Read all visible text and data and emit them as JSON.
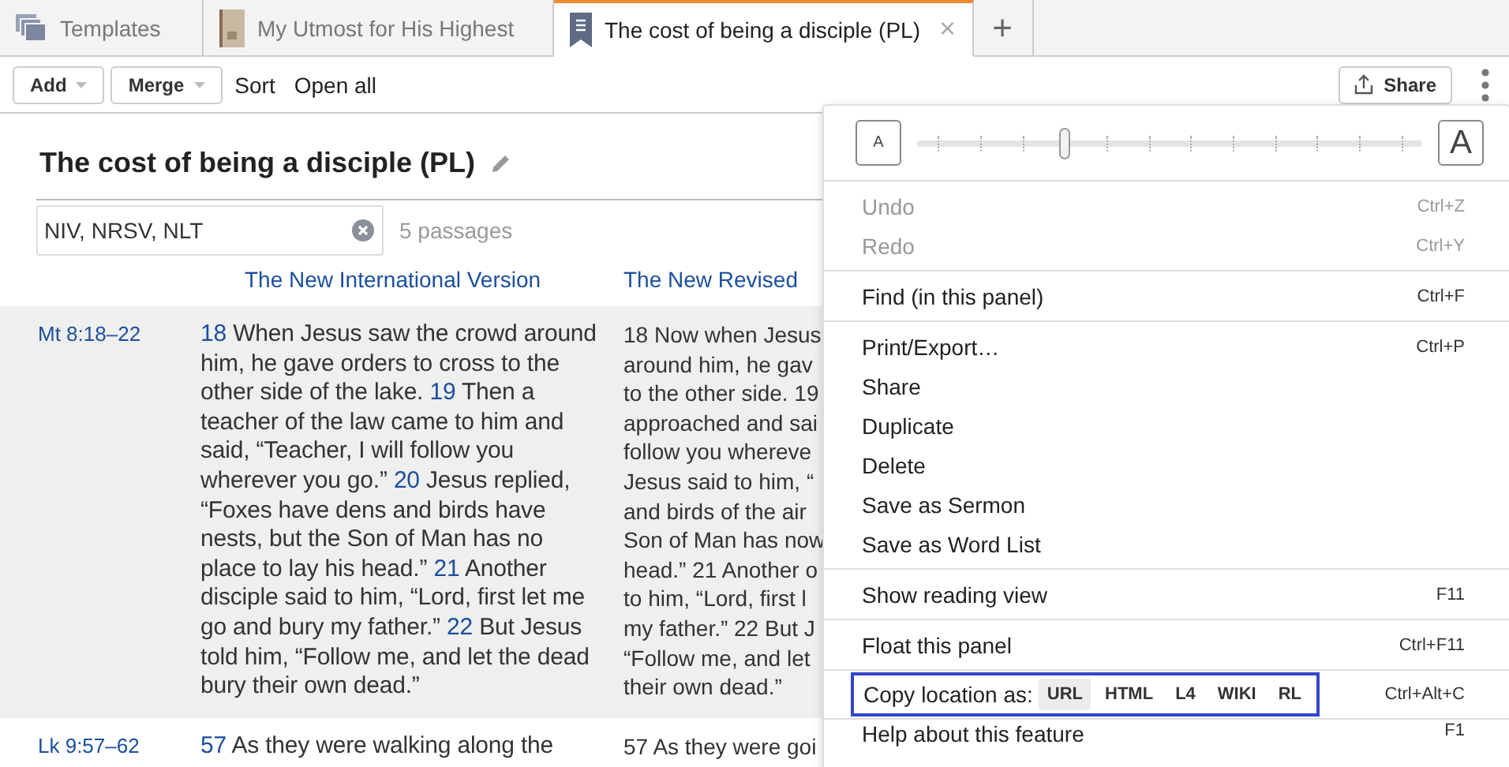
{
  "tabs": [
    {
      "label": "Templates",
      "selected": false
    },
    {
      "label": "My Utmost for His Highest",
      "selected": false
    },
    {
      "label": "The cost of being a disciple (PL)",
      "selected": true,
      "close": "×"
    }
  ],
  "new_tab": "+",
  "toolbar": {
    "dropdowns": [
      "Add",
      "Merge"
    ],
    "links": [
      "Sort",
      "Open all"
    ],
    "share": "Share"
  },
  "document": {
    "title": "The cost of being a disciple (PL)",
    "versions_field": {
      "value": "NIV, NRSV, NLT"
    },
    "passage_count": "5 passages",
    "columns": [
      "The New International Version",
      "The New Revised"
    ],
    "rows": [
      {
        "reference": "Mt 8:18–22",
        "shaded": true,
        "niv": [
          {
            "number": "18",
            "text": "When Jesus saw the crowd around him, he gave orders to cross to the other side of the lake."
          },
          {
            "number": "19",
            "text": "Then a teacher of the law came to him and said, “Teacher, I will follow you wherever you go.”"
          },
          {
            "number": "20",
            "text": "Jesus replied, “Foxes have dens and birds have nests, but the Son of Man has no place to lay his head.”"
          },
          {
            "number": "21",
            "text": "Another disciple said to him, “Lord, first let me go and bury my father.”"
          },
          {
            "number": "22",
            "text": "But Jesus told him, “Follow me, and let the dead bury their own dead.”"
          }
        ],
        "nrsv_lines": [
          "18 Now when Jesus",
          "around him, he gav",
          "to the other side. 19",
          "approached and sai",
          "follow you whereve",
          "Jesus said to him, “",
          "and birds of the air",
          "Son of Man has now",
          "head.” 21 Another o",
          "to him, “Lord, first l",
          "my father.” 22 But J",
          "“Follow me, and let",
          "their own dead.”"
        ]
      },
      {
        "reference": "Lk 9:57–62",
        "shaded": false,
        "niv": [
          {
            "number": "57",
            "text": "As they were walking along the"
          }
        ],
        "nrsv_lines": [
          "57 As they were goi"
        ]
      }
    ]
  },
  "menu": {
    "font_slider": {
      "small": "A",
      "large": "A",
      "level": 0.29
    },
    "groups": [
      [
        {
          "label": "Undo",
          "shortcut": "Ctrl+Z",
          "disabled": true
        },
        {
          "label": "Redo",
          "shortcut": "Ctrl+Y",
          "disabled": true
        }
      ],
      [
        {
          "label": "Find (in this panel)",
          "shortcut": "Ctrl+F",
          "disabled": false
        }
      ],
      [
        {
          "label": "Print/Export…",
          "shortcut": "Ctrl+P",
          "disabled": false
        },
        {
          "label": "Share",
          "disabled": false
        },
        {
          "label": "Duplicate",
          "disabled": false
        },
        {
          "label": "Delete",
          "disabled": false
        },
        {
          "label": "Save as Sermon",
          "disabled": false
        },
        {
          "label": "Save as Word List",
          "disabled": false
        }
      ],
      [
        {
          "label": "Show reading view",
          "shortcut": "F11",
          "disabled": false
        }
      ],
      [
        {
          "label": "Float this panel",
          "shortcut": "Ctrl+F11",
          "disabled": false
        }
      ]
    ],
    "copy_location": {
      "label": "Copy location as:",
      "focused": true,
      "options": [
        {
          "label": "URL",
          "selected": true
        },
        {
          "label": "HTML",
          "selected": false
        },
        {
          "label": "L4",
          "selected": false
        },
        {
          "label": "WIKI",
          "selected": false
        },
        {
          "label": "RL",
          "selected": false
        }
      ],
      "shortcut": "Ctrl+Alt+C"
    },
    "help": {
      "label": "Help about this feature",
      "shortcut": "F1"
    }
  }
}
